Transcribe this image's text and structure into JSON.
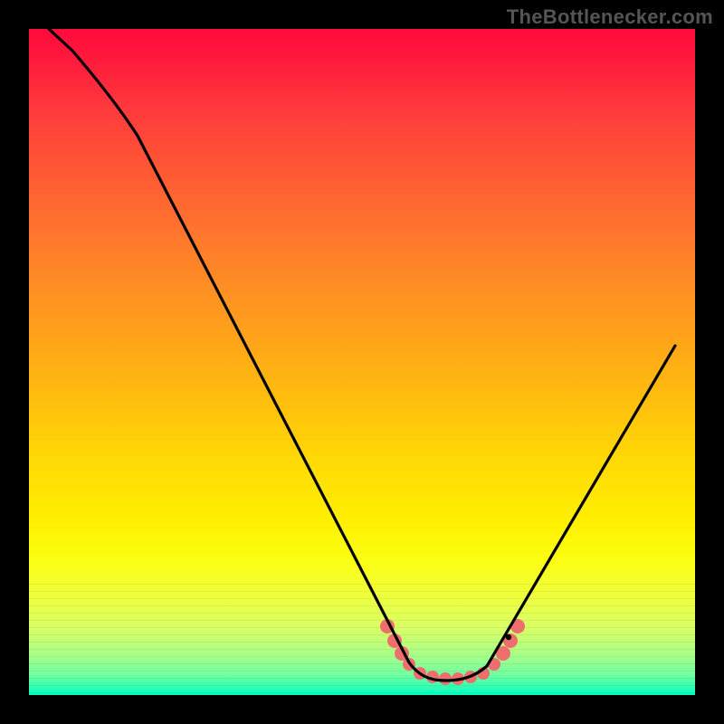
{
  "attribution": "TheBottlenecker.com",
  "chart_data": {
    "type": "line",
    "title": "",
    "xlabel": "",
    "ylabel": "",
    "xlim": [
      0,
      100
    ],
    "ylim": [
      0,
      100
    ],
    "series": [
      {
        "name": "bottleneck-curve",
        "x": [
          3,
          6,
          15,
          30,
          42,
          55,
          59,
          62,
          65,
          68,
          71,
          74,
          95
        ],
        "y": [
          100,
          97,
          88,
          61,
          39,
          12,
          5,
          3,
          3,
          4,
          6,
          11,
          48
        ]
      }
    ],
    "annotations": [
      {
        "name": "valley-marker",
        "x_range": [
          55,
          73
        ],
        "color": "#ee6e6e"
      }
    ],
    "background": {
      "gradient_top": "#ff0a3c",
      "gradient_mid": "#fff000",
      "gradient_bottom": "#00ffc0"
    }
  }
}
